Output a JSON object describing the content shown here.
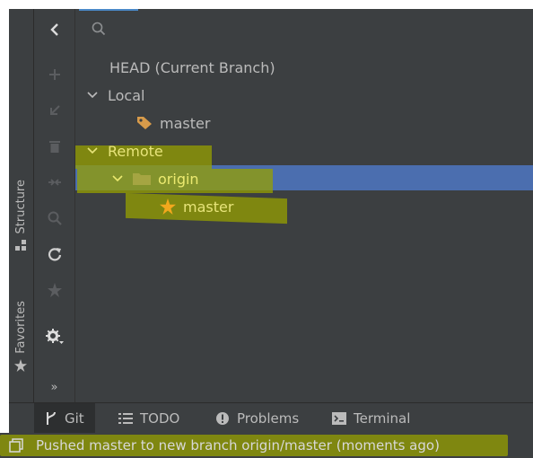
{
  "sidebar": {
    "tabs": [
      {
        "label": "Structure",
        "icon": "structure-icon"
      },
      {
        "label": "Favorites",
        "icon": "star-icon"
      }
    ]
  },
  "toolbar": {
    "buttons": [
      "collapse-icon",
      "add-icon",
      "checkout-icon",
      "delete-icon",
      "compare-icon",
      "search-icon",
      "refresh-icon",
      "favorite-icon",
      "settings-icon",
      "more-icon"
    ],
    "more_label": "»"
  },
  "tree": {
    "search_placeholder": "",
    "nodes": [
      {
        "label": "HEAD (Current Branch)",
        "level": 0,
        "expandable": false,
        "icon": ""
      },
      {
        "label": "Local",
        "level": 0,
        "expandable": true,
        "icon": ""
      },
      {
        "label": "master",
        "level": 1,
        "expandable": false,
        "icon": "tag-icon"
      },
      {
        "label": "Remote",
        "level": 0,
        "expandable": true,
        "icon": ""
      },
      {
        "label": "origin",
        "level": 1,
        "expandable": true,
        "icon": "folder-icon",
        "selected": true
      },
      {
        "label": "master",
        "level": 2,
        "expandable": false,
        "icon": "star-icon"
      }
    ]
  },
  "bottom_tabs": [
    {
      "label": "Git",
      "icon": "git-branch-icon",
      "active": true
    },
    {
      "label": "TODO",
      "icon": "list-icon",
      "active": false
    },
    {
      "label": "Problems",
      "icon": "problems-icon",
      "active": false
    },
    {
      "label": "Terminal",
      "icon": "terminal-icon",
      "active": false
    }
  ],
  "status": {
    "message": "Pushed master to new branch origin/master (moments ago)"
  },
  "colors": {
    "panel": "#3c3f41",
    "selection": "#4b6eaf",
    "highlight": "#969f00",
    "tag": "#d89b4a",
    "star": "#f2a81d",
    "folder": "#a5a542"
  }
}
